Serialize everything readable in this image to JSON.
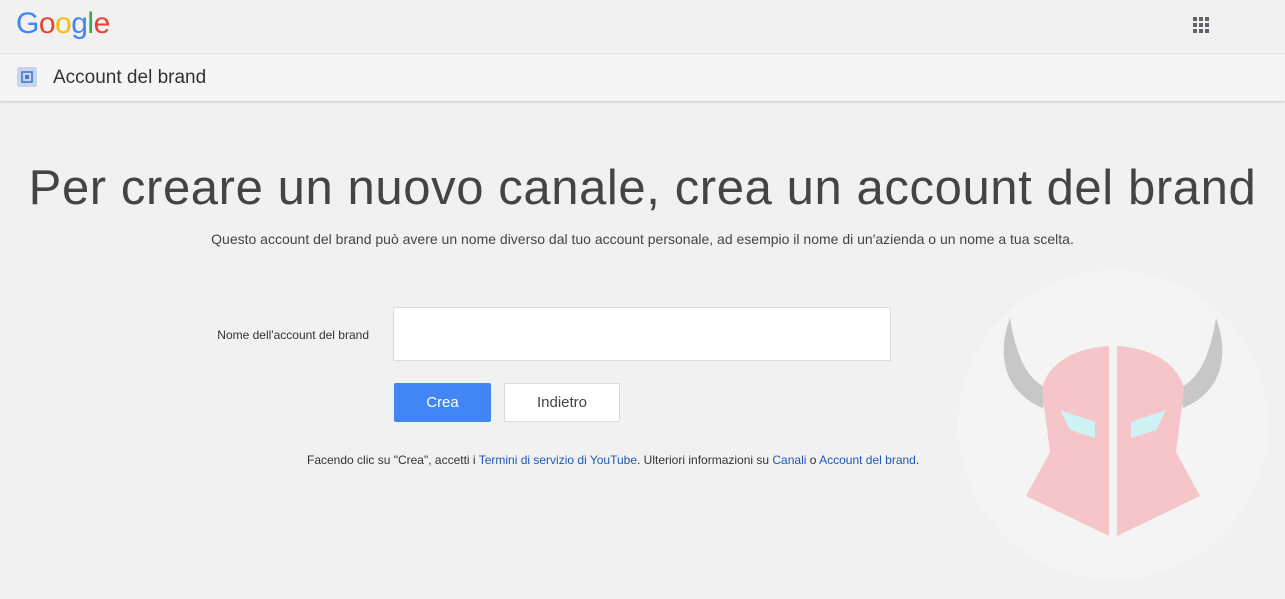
{
  "header": {
    "logo_letters": [
      {
        "ch": "G",
        "color": "#4285F4"
      },
      {
        "ch": "o",
        "color": "#EA4335"
      },
      {
        "ch": "o",
        "color": "#FBBC05"
      },
      {
        "ch": "g",
        "color": "#4285F4"
      },
      {
        "ch": "l",
        "color": "#34A853"
      },
      {
        "ch": "e",
        "color": "#EA4335"
      }
    ],
    "apps_icon": "apps-grid-icon"
  },
  "subheader": {
    "icon": "brand-account-icon",
    "title": "Account del brand"
  },
  "main": {
    "headline": "Per creare un nuovo canale, crea un account del brand",
    "subtitle": "Questo account del brand può avere un nome diverso dal tuo account personale, ad esempio il nome di un'azienda o un nome a tua scelta.",
    "field_label": "Nome dell'account del brand",
    "field_value": "",
    "create_button": "Crea",
    "back_button": "Indietro",
    "terms": {
      "prefix": "Facendo clic su \"Crea\", accetti i ",
      "tos_link": "Termini di servizio di YouTube",
      "middle": ". Ulteriori informazioni su ",
      "channels_link": "Canali",
      "or": " o ",
      "brand_link": "Account del brand",
      "suffix": "."
    }
  },
  "colors": {
    "accent": "#4285f4",
    "link": "#2158b6",
    "background": "#f1f1f1"
  },
  "watermark": {
    "icon": "helmet-logo-icon"
  }
}
